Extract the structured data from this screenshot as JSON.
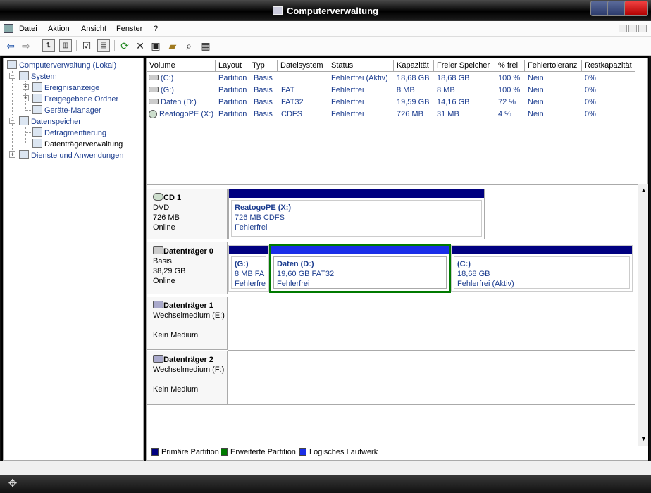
{
  "window": {
    "title": "Computerverwaltung"
  },
  "menu": {
    "items": [
      "Datei",
      "Aktion",
      "Ansicht",
      "Fenster",
      "?"
    ]
  },
  "toolbar": {
    "icons": [
      "back-icon",
      "forward-icon",
      "up-icon",
      "show-tree-icon",
      "properties-icon",
      "export-icon",
      "refresh-icon",
      "delete-icon",
      "properties-sheet-icon",
      "open-icon",
      "search-icon",
      "help-icon"
    ]
  },
  "tree": {
    "root": "Computerverwaltung (Lokal)",
    "system": "System",
    "events": "Ereignisanzeige",
    "shared": "Freigegebene Ordner",
    "devmgr": "Geräte-Manager",
    "storage": "Datenspeicher",
    "defrag": "Defragmentierung",
    "diskmgmt": "Datenträgerverwaltung",
    "services": "Dienste und Anwendungen"
  },
  "volumes": {
    "columns": [
      "Volume",
      "Layout",
      "Typ",
      "Dateisystem",
      "Status",
      "Kapazität",
      "Freier Speicher",
      "% frei",
      "Fehlertoleranz",
      "Restkapazität"
    ],
    "rows": [
      [
        "(C:)",
        "Partition",
        "Basis",
        "",
        "Fehlerfrei (Aktiv)",
        "18,68 GB",
        "18,68 GB",
        "100 %",
        "Nein",
        "0%"
      ],
      [
        "(G:)",
        "Partition",
        "Basis",
        "FAT",
        "Fehlerfrei",
        "8 MB",
        "8 MB",
        "100 %",
        "Nein",
        "0%"
      ],
      [
        "Daten (D:)",
        "Partition",
        "Basis",
        "FAT32",
        "Fehlerfrei",
        "19,59 GB",
        "14,16 GB",
        "72 %",
        "Nein",
        "0%"
      ],
      [
        "ReatogoPE (X:)",
        "Partition",
        "Basis",
        "CDFS",
        "Fehlerfrei",
        "726 MB",
        "31 MB",
        "4 %",
        "Nein",
        "0%"
      ]
    ]
  },
  "disks": {
    "cd1": {
      "name": "CD 1",
      "type": "DVD",
      "size": "726 MB",
      "state": "Online",
      "part_name": "ReatogoPE  (X:)",
      "part_size": "726 MB CDFS",
      "part_status": "Fehlerfrei"
    },
    "disk0": {
      "name": "Datenträger 0",
      "type": "Basis",
      "size": "38,29 GB",
      "state": "Online",
      "g_name": "(G:)",
      "g_size": "8 MB FA",
      "g_status": "Fehlerfre",
      "d_name": "Daten  (D:)",
      "d_size": "19,60 GB FAT32",
      "d_status": "Fehlerfrei",
      "c_name": "(C:)",
      "c_size": "18,68 GB",
      "c_status": "Fehlerfrei (Aktiv)"
    },
    "disk1": {
      "name": "Datenträger 1",
      "type": "Wechselmedium (E:)",
      "state": "Kein Medium"
    },
    "disk2": {
      "name": "Datenträger 2",
      "type": "Wechselmedium (F:)",
      "state": "Kein Medium"
    }
  },
  "legend": {
    "primary": "Primäre Partition",
    "extended": "Erweiterte Partition",
    "logical": "Logisches Laufwerk"
  },
  "colors": {
    "primary": "#000080",
    "extended": "#007a00",
    "logical": "#1a2ee8",
    "titlebar": "#000000",
    "close": "#d00000"
  }
}
